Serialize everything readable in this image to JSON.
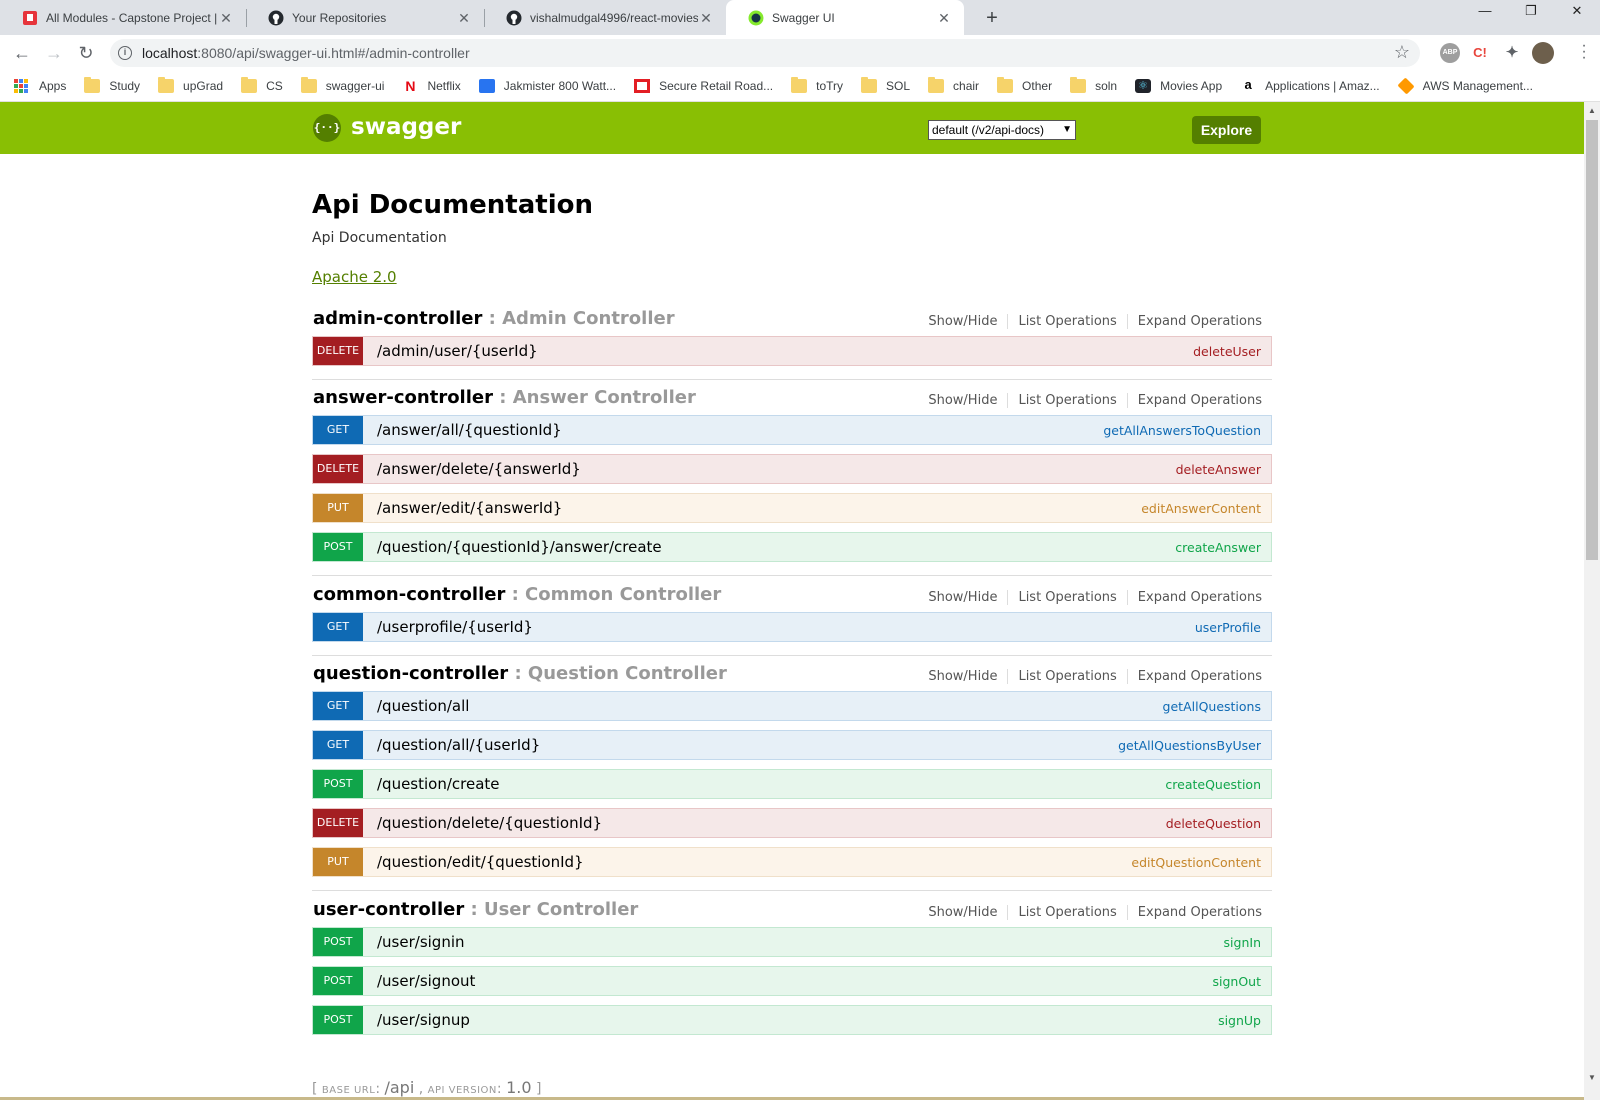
{
  "browser": {
    "tabs": [
      {
        "title": "All Modules - Capstone Project |",
        "icon": "upgrad-icon"
      },
      {
        "title": "Your Repositories",
        "icon": "github-icon"
      },
      {
        "title": "vishalmudgal4996/react-movies-",
        "icon": "github-icon"
      },
      {
        "title": "Swagger UI",
        "icon": "swagger-favicon"
      }
    ],
    "close_glyph": "✕",
    "new_tab_glyph": "+",
    "url_host": "localhost",
    "url_rest": ":8080/api/swagger-ui.html#/admin-controller",
    "extensions": {
      "abp": "ABP",
      "c": "C!"
    },
    "bookmarks": [
      {
        "label": "Apps",
        "icon": "apps-grid-icon"
      },
      {
        "label": "Study",
        "icon": "folder-icon"
      },
      {
        "label": "upGrad",
        "icon": "folder-icon"
      },
      {
        "label": "CS",
        "icon": "folder-icon"
      },
      {
        "label": "swagger-ui",
        "icon": "folder-icon"
      },
      {
        "label": "Netflix",
        "icon": "netflix-icon"
      },
      {
        "label": "Jakmister 800 Watt...",
        "icon": "flipkart-icon"
      },
      {
        "label": "Secure Retail Road...",
        "icon": "bank-icon"
      },
      {
        "label": "toTry",
        "icon": "folder-icon"
      },
      {
        "label": "SOL",
        "icon": "folder-icon"
      },
      {
        "label": "chair",
        "icon": "folder-icon"
      },
      {
        "label": "Other",
        "icon": "folder-icon"
      },
      {
        "label": "soln",
        "icon": "folder-icon"
      },
      {
        "label": "Movies App",
        "icon": "react-icon"
      },
      {
        "label": "Applications | Amaz...",
        "icon": "amazon-icon"
      },
      {
        "label": "AWS Management...",
        "icon": "aws-icon"
      }
    ]
  },
  "swagger": {
    "logo_glyph": "{··}",
    "logo_text": "swagger",
    "spec_select": "default (/v2/api-docs)",
    "explore_label": "Explore",
    "title": "Api Documentation",
    "description": "Api Documentation",
    "license": "Apache 2.0",
    "ops_labels": {
      "show_hide": "Show/Hide",
      "list": "List Operations",
      "expand": "Expand Operations"
    },
    "groups": [
      {
        "name": "admin-controller",
        "desc": " : Admin Controller",
        "operations": [
          {
            "method": "DELETE",
            "path": "/admin/user/{userId}",
            "nickname": "deleteUser"
          }
        ]
      },
      {
        "name": "answer-controller",
        "desc": " : Answer Controller",
        "operations": [
          {
            "method": "GET",
            "path": "/answer/all/{questionId}",
            "nickname": "getAllAnswersToQuestion"
          },
          {
            "method": "DELETE",
            "path": "/answer/delete/{answerId}",
            "nickname": "deleteAnswer"
          },
          {
            "method": "PUT",
            "path": "/answer/edit/{answerId}",
            "nickname": "editAnswerContent"
          },
          {
            "method": "POST",
            "path": "/question/{questionId}/answer/create",
            "nickname": "createAnswer"
          }
        ]
      },
      {
        "name": "common-controller",
        "desc": " : Common Controller",
        "operations": [
          {
            "method": "GET",
            "path": "/userprofile/{userId}",
            "nickname": "userProfile"
          }
        ]
      },
      {
        "name": "question-controller",
        "desc": " : Question Controller",
        "operations": [
          {
            "method": "GET",
            "path": "/question/all",
            "nickname": "getAllQuestions"
          },
          {
            "method": "GET",
            "path": "/question/all/{userId}",
            "nickname": "getAllQuestionsByUser"
          },
          {
            "method": "POST",
            "path": "/question/create",
            "nickname": "createQuestion"
          },
          {
            "method": "DELETE",
            "path": "/question/delete/{questionId}",
            "nickname": "deleteQuestion"
          },
          {
            "method": "PUT",
            "path": "/question/edit/{questionId}",
            "nickname": "editQuestionContent"
          }
        ]
      },
      {
        "name": "user-controller",
        "desc": " : User Controller",
        "operations": [
          {
            "method": "POST",
            "path": "/user/signin",
            "nickname": "signIn"
          },
          {
            "method": "POST",
            "path": "/user/signout",
            "nickname": "signOut"
          },
          {
            "method": "POST",
            "path": "/user/signup",
            "nickname": "signUp"
          }
        ]
      }
    ],
    "footer": {
      "open": "[ ",
      "base_label": "BASE URL",
      "base": "/api",
      "sep": " , ",
      "ver_label": "API VERSION",
      "version": "1.0",
      "close": " ]"
    }
  },
  "colors": {
    "swagger_green": "#89bf04",
    "get": "#0f6ab4",
    "post": "#10a54a",
    "put": "#c5862b",
    "delete": "#a41e22"
  }
}
